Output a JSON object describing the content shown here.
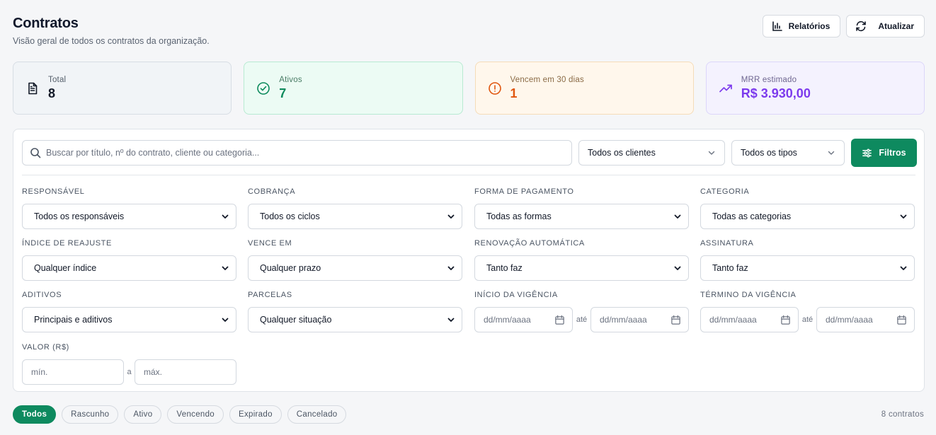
{
  "header": {
    "title": "Contratos",
    "subtitle": "Visão geral de todos os contratos da organização."
  },
  "actions": {
    "reports_label": "Relatórios",
    "refresh_label": "Atualizar"
  },
  "stats": {
    "total": {
      "label": "Total",
      "value": "8",
      "icon": "document-icon"
    },
    "ativos": {
      "label": "Ativos",
      "value": "7",
      "icon": "check-circle-icon"
    },
    "vencem": {
      "label": "Vencem em 30 dias",
      "value": "1",
      "icon": "alert-circle-icon"
    },
    "mrr": {
      "label": "MRR estimado",
      "value": "R$ 3.930,00",
      "icon": "trending-up-icon"
    }
  },
  "search": {
    "placeholder": "Buscar por título, nº do contrato, cliente ou categoria...",
    "value": ""
  },
  "quick_filters": {
    "clientes": "Todos os clientes",
    "tipos": "Todos os tipos",
    "filtros_label": "Filtros"
  },
  "fields": {
    "responsavel": {
      "label": "Responsável",
      "value": "Todos os responsáveis"
    },
    "cobranca": {
      "label": "Cobrança",
      "value": "Todos os ciclos"
    },
    "forma_pagamento": {
      "label": "Forma de pagamento",
      "value": "Todas as formas"
    },
    "categoria": {
      "label": "Categoria",
      "value": "Todas as categorias"
    },
    "indice_reajuste": {
      "label": "Índice de reajuste",
      "value": "Qualquer índice"
    },
    "vence_em": {
      "label": "Vence em",
      "value": "Qualquer prazo"
    },
    "renovacao": {
      "label": "Renovação automática",
      "value": "Tanto faz"
    },
    "assinatura": {
      "label": "Assinatura",
      "value": "Tanto faz"
    },
    "aditivos": {
      "label": "Aditivos",
      "value": "Principais e aditivos"
    },
    "parcelas": {
      "label": "Parcelas",
      "value": "Qualquer situação"
    },
    "inicio_vigencia": {
      "label": "Início da vigência",
      "from_placeholder": "dd/mm/aaaa",
      "sep": "até",
      "to_placeholder": "dd/mm/aaaa"
    },
    "termino_vigencia": {
      "label": "Término da vigência",
      "from_placeholder": "dd/mm/aaaa",
      "sep": "até",
      "to_placeholder": "dd/mm/aaaa"
    },
    "valor": {
      "label": "Valor (R$)",
      "min_placeholder": "mín.",
      "sep": "a",
      "max_placeholder": "máx."
    }
  },
  "status_tabs": [
    "Todos",
    "Rascunho",
    "Ativo",
    "Vencendo",
    "Expirado",
    "Cancelado"
  ],
  "count_text": "8 contratos",
  "colors": {
    "primary": "#0e8a5f",
    "warning": "#e0560f",
    "purple": "#7c3aed"
  }
}
